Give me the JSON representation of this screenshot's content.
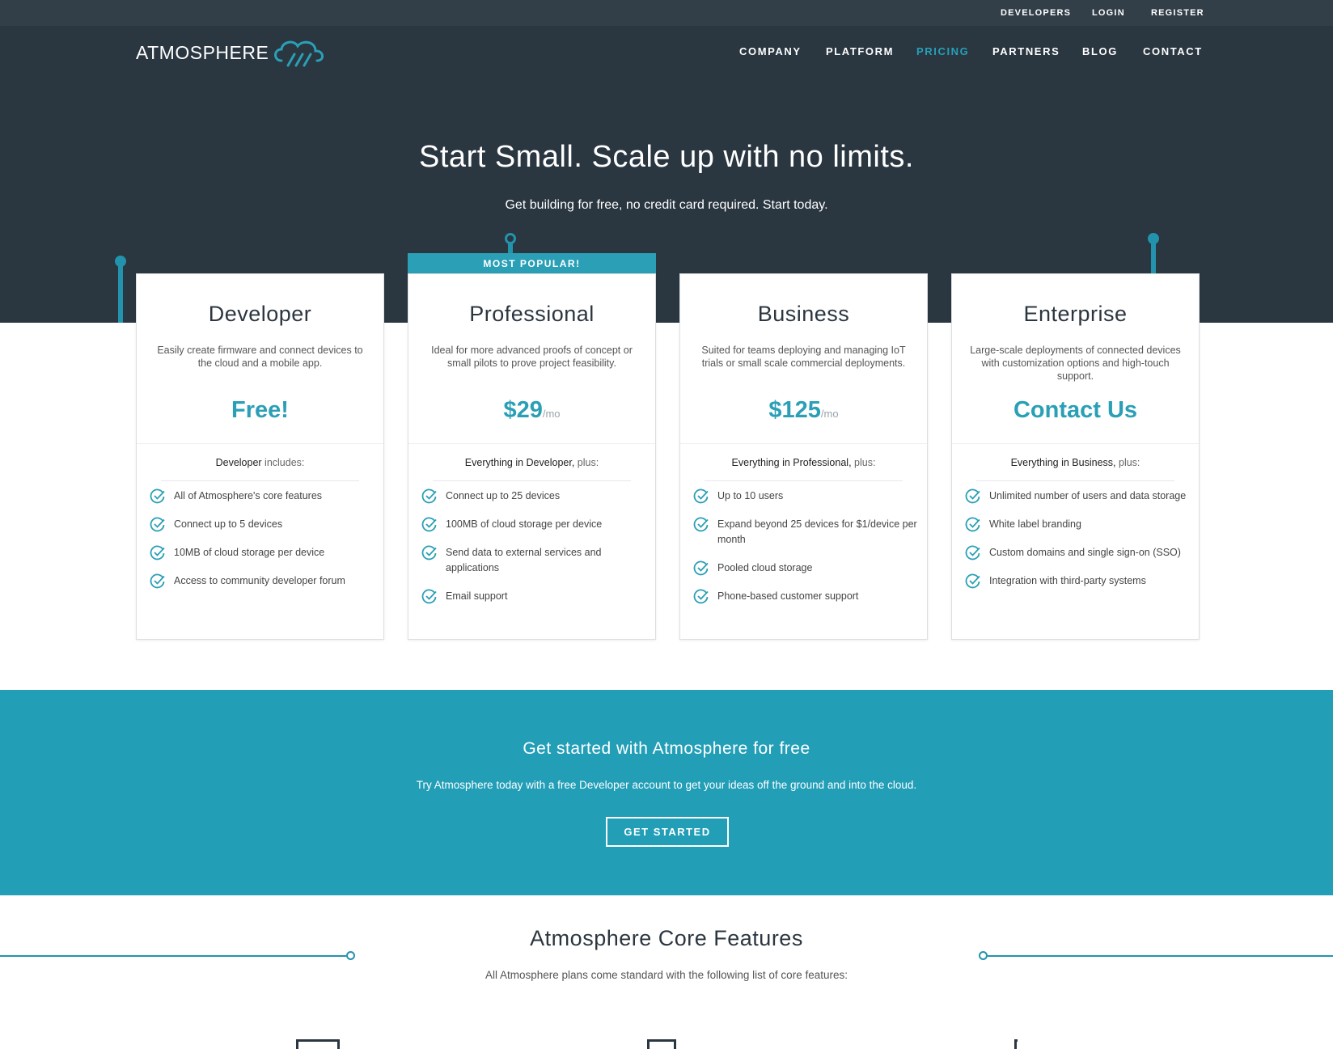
{
  "topbar": {
    "links": [
      "DEVELOPERS",
      "LOGIN",
      "REGISTER"
    ]
  },
  "header": {
    "logo_text": "ATMOSPHERE",
    "nav": [
      "COMPANY",
      "PLATFORM",
      "PRICING",
      "PARTNERS",
      "BLOG",
      "CONTACT"
    ],
    "active_nav": "PRICING"
  },
  "hero": {
    "title": "Start Small. Scale up with no limits.",
    "subtitle": "Get building for free, no credit card required. Start today."
  },
  "plans": [
    {
      "name": "Developer",
      "description": "Easily create firmware and connect devices to the cloud and a mobile app.",
      "price": "Free!",
      "per": "",
      "includes_strong": "Developer",
      "includes_rest": " includes:",
      "features": [
        "All of Atmosphere's core features",
        "Connect up to 5 devices",
        "10MB of cloud storage per device",
        "Access to community developer forum"
      ]
    },
    {
      "name": "Professional",
      "badge": "MOST POPULAR!",
      "description": "Ideal for more advanced proofs of concept or small pilots to prove project feasibility.",
      "price": "$29",
      "per": "/mo",
      "includes_strong": "Everything in Developer,",
      "includes_rest": " plus:",
      "features": [
        "Connect up to 25 devices",
        "100MB of cloud storage per device",
        "Send data to external services and applications",
        "Email support"
      ]
    },
    {
      "name": "Business",
      "description": "Suited for teams deploying and managing IoT trials or small scale commercial deployments.",
      "price": "$125",
      "per": "/mo",
      "includes_strong": "Everything in Professional,",
      "includes_rest": " plus:",
      "features": [
        "Up to 10 users",
        "Expand beyond 25 devices for $1/device per month",
        "Pooled cloud storage",
        "Phone-based customer support"
      ]
    },
    {
      "name": "Enterprise",
      "description": "Large-scale deployments of connected devices with customization options and high-touch support.",
      "price": "Contact Us",
      "per": "",
      "includes_strong": "Everything in Business,",
      "includes_rest": " plus:",
      "features": [
        "Unlimited number of users and data storage",
        "White label branding",
        "Custom domains and single sign-on (SSO)",
        "Integration with third-party systems"
      ]
    }
  ],
  "cta": {
    "title": "Get started with Atmosphere for free",
    "subtitle": "Try Atmosphere today with a free Developer account to get your ideas off the ground and into the cloud.",
    "button": "GET STARTED"
  },
  "core": {
    "title": "Atmosphere Core Features",
    "subtitle": "All Atmosphere plans come standard with the following list of core features:"
  },
  "colors": {
    "accent": "#2a9fb6",
    "hero_bg": "#2a3640",
    "topbar_bg": "#323e48",
    "cta_bg": "#229eb7"
  }
}
